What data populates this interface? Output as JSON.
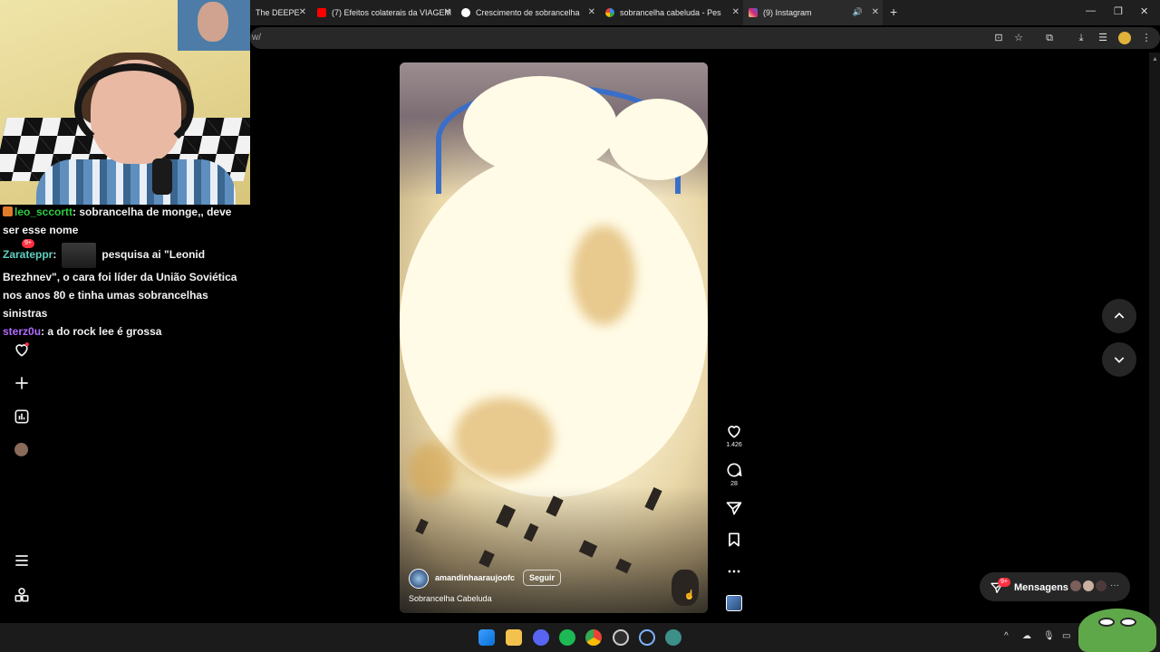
{
  "browser": {
    "tabs": [
      {
        "label": "The DEEPE",
        "icon": "blank-tab-icon",
        "active": false
      },
      {
        "label": "(7) Efeitos colaterais da VIAGEM",
        "icon": "youtube-icon",
        "active": false
      },
      {
        "label": "Crescimento de sobrancelha",
        "icon": "chatgpt-icon",
        "active": false
      },
      {
        "label": "sobrancelha cabeluda - Pesquis",
        "icon": "google-icon",
        "active": false
      },
      {
        "label": "(9) Instagram",
        "icon": "instagram-icon",
        "active": true
      }
    ],
    "address_fragment": "w/",
    "colors": {
      "tabbar": "#1f1f1f",
      "youtube": "#ff0000",
      "instagram": "#d62976"
    }
  },
  "chat": {
    "messages": [
      {
        "user": "leo_sccortt",
        "text": "sobrancelha de monge,, deve ser esse nome"
      },
      {
        "user": "Zarateppr",
        "badge": "9+",
        "text": "pesquisa ai \"Leonid Brezhnev\", o cara foi líder da União Soviética nos anos 80 e tinha umas sobrancelhas sinistras"
      },
      {
        "user": "sterz0u",
        "text": "a do rock lee é grossa"
      }
    ]
  },
  "reel": {
    "username": "amandinhaaraujoofc",
    "follow_label": "Seguir",
    "caption": "Sobrancelha Cabeluda",
    "likes": "1.426",
    "comments": "28"
  },
  "messages": {
    "label": "Mensagens",
    "badge": "9+"
  },
  "icons": {
    "nav": [
      "heart-icon",
      "plus-icon",
      "dashboard-icon",
      "profile-avatar",
      "menu-icon",
      "threads-icon"
    ],
    "actions": [
      "like-icon",
      "comment-icon",
      "share-icon",
      "save-icon",
      "more-icon"
    ]
  }
}
